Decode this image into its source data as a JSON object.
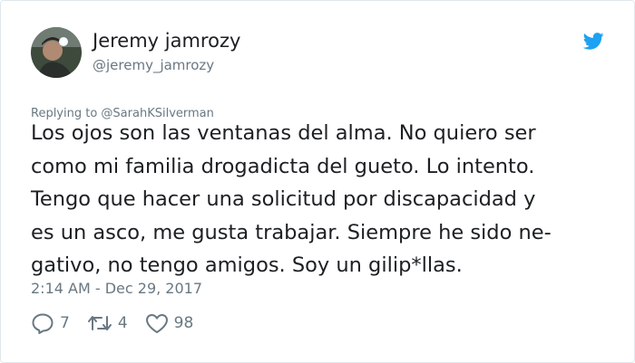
{
  "author": {
    "name": "Jeremy jamrozy",
    "handle": "@jeremy_jamrozy"
  },
  "brand_icon": "twitter-bird-icon",
  "reply_context": "Replying to @SarahKSilverman",
  "tweet": {
    "lines": [
      "Los ojos son las ventanas del alma. No quiero ser",
      "como mi familia drogadicta del gueto. Lo intento.",
      "Tengo que hacer una solicitud por discapacidad y",
      "es un asco, me  gusta trabajar. Siempre he sido ne-",
      "gativo, no tengo amigos. Soy un gilip*llas."
    ]
  },
  "timestamp": "2:14 AM - Dec 29, 2017",
  "actions": {
    "replies": "7",
    "retweets": "4",
    "likes": "98"
  },
  "colors": {
    "text": "#1c2022",
    "secondary": "#697882",
    "twitter_blue": "#1da1f2",
    "border": "#e1e8ed"
  }
}
